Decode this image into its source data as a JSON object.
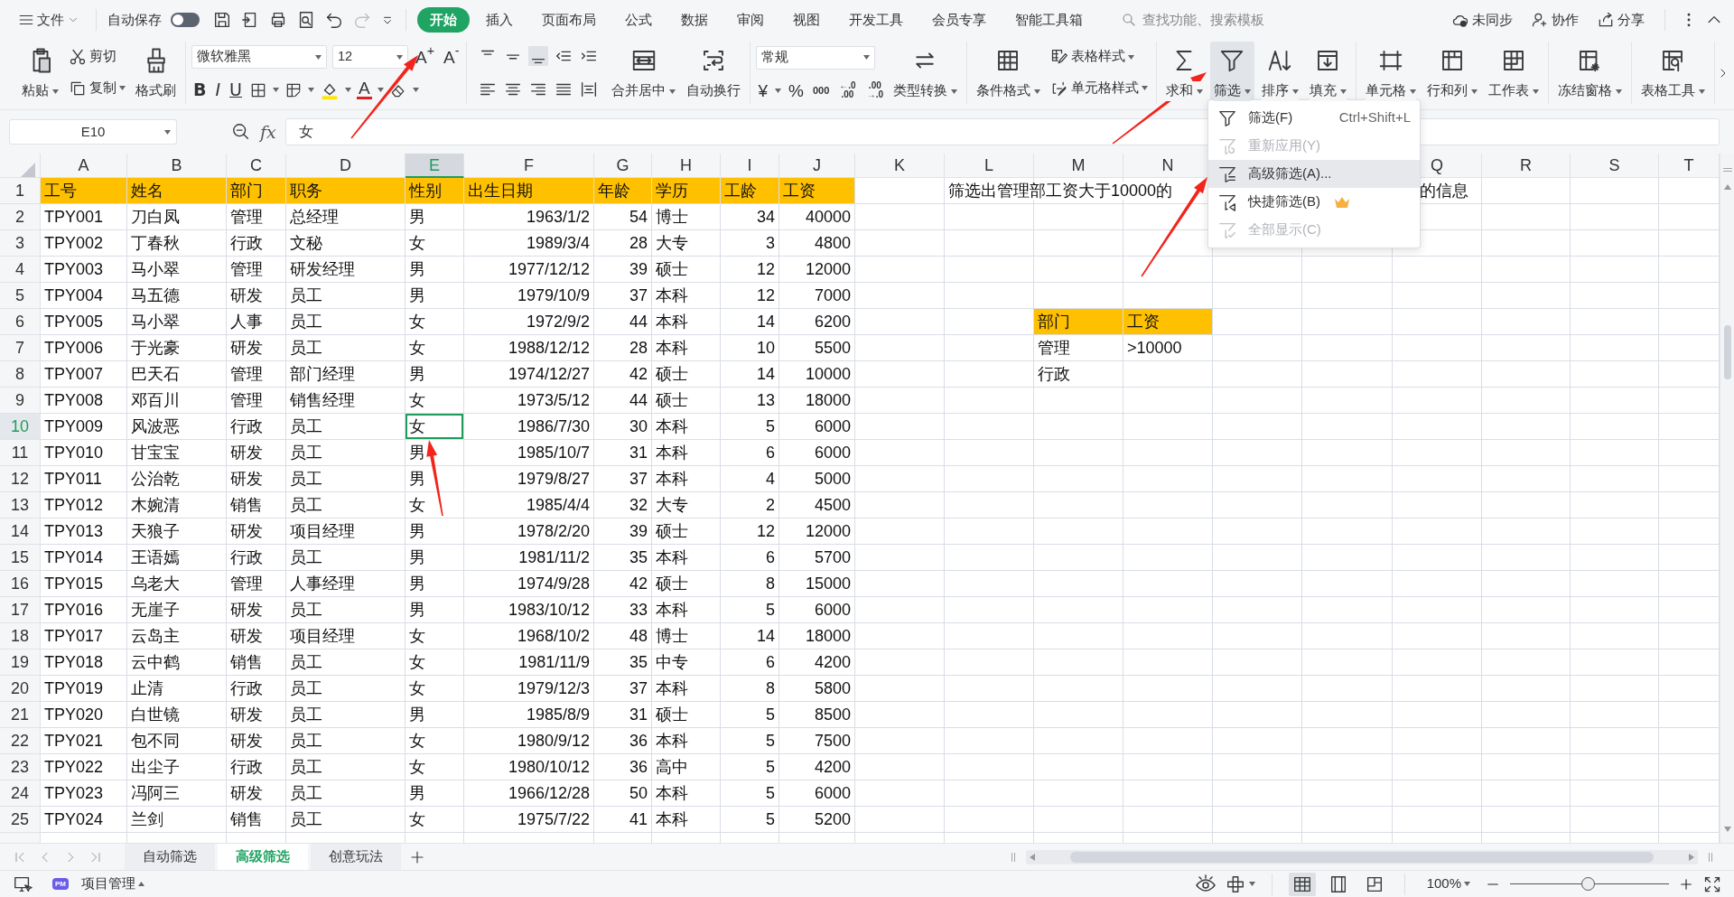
{
  "top_bar": {
    "file_menu": "文件",
    "autosave_label": "自动保存",
    "autosave_on": false,
    "redo_disabled": true,
    "tabs": [
      {
        "label": "开始",
        "selected": true
      },
      {
        "label": "插入",
        "selected": false
      },
      {
        "label": "页面布局",
        "selected": false
      },
      {
        "label": "公式",
        "selected": false
      },
      {
        "label": "数据",
        "selected": false
      },
      {
        "label": "审阅",
        "selected": false
      },
      {
        "label": "视图",
        "selected": false
      },
      {
        "label": "开发工具",
        "selected": false
      },
      {
        "label": "会员专享",
        "selected": false
      },
      {
        "label": "智能工具箱",
        "selected": false
      }
    ],
    "search": {
      "placeholder": "查找功能、搜索模板"
    },
    "actions": [
      {
        "label": "未同步"
      },
      {
        "label": "协作"
      },
      {
        "label": "分享"
      }
    ]
  },
  "ribbon": {
    "groups": [
      {
        "items": [
          {
            "kind": "big",
            "label": "粘贴",
            "caret": true,
            "expanded": false
          },
          {
            "kind": "stack",
            "items": [
              {
                "label": "剪切",
                "caret": false
              },
              {
                "label": "复制",
                "caret": true
              }
            ]
          },
          {
            "kind": "big",
            "label": "格式刷",
            "caret": false,
            "expanded": false
          }
        ]
      },
      {
        "items": [
          {
            "kind": "font",
            "font": "微软雅黑",
            "size": "12",
            "grow": "A$^{+}$",
            "shrink": "A$^{-}$",
            "styles": [
              "B",
              "I",
              "U"
            ],
            "font_color": "A"
          }
        ]
      },
      {
        "items": [
          {
            "kind": "align"
          },
          {
            "kind": "big",
            "label": "合并居中",
            "caret": true,
            "expanded": false
          },
          {
            "kind": "big",
            "label": "自动换行",
            "caret": false,
            "expanded": false
          }
        ]
      },
      {
        "items": [
          {
            "kind": "number",
            "format": "常规",
            "currency": "¥",
            "percent": "%",
            "thousands": "000",
            "decimals": [
              {
                "top": "←.0",
                "bottom": ".00"
              },
              {
                "top": ".00",
                "bottom": "→.0"
              }
            ]
          },
          {
            "kind": "big",
            "label": "类型转换",
            "caret": true,
            "expanded": false
          }
        ]
      },
      {
        "items": [
          {
            "kind": "big",
            "label": "条件格式",
            "caret": true,
            "expanded": false
          },
          {
            "kind": "stack",
            "items": [
              {
                "label": "表格样式",
                "caret": true
              },
              {
                "label": "单元格样式",
                "caret": true
              }
            ]
          }
        ]
      },
      {
        "items": [
          {
            "kind": "big",
            "label": "求和",
            "caret": true,
            "expanded": false
          },
          {
            "kind": "big",
            "label": "筛选",
            "caret": true,
            "expanded": true
          },
          {
            "kind": "big",
            "label": "排序",
            "caret": true,
            "expanded": false
          },
          {
            "kind": "big",
            "label": "填充",
            "caret": true,
            "expanded": false
          }
        ]
      },
      {
        "items": [
          {
            "kind": "big",
            "label": "单元格",
            "caret": true,
            "expanded": false
          },
          {
            "kind": "big",
            "label": "行和列",
            "caret": true,
            "expanded": false
          },
          {
            "kind": "big",
            "label": "工作表",
            "caret": true,
            "expanded": false
          }
        ]
      },
      {
        "items": [
          {
            "kind": "big",
            "label": "冻结窗格",
            "caret": true,
            "expanded": false
          }
        ]
      },
      {
        "items": [
          {
            "kind": "big",
            "label": "表格工具",
            "caret": true,
            "expanded": false
          }
        ]
      }
    ]
  },
  "formula_bar": {
    "name_box": "E10",
    "fx": "fx",
    "value": "女"
  },
  "sheet": {
    "columns": [
      {
        "letter": "A",
        "selected": false
      },
      {
        "letter": "B",
        "selected": false
      },
      {
        "letter": "C",
        "selected": false
      },
      {
        "letter": "D",
        "selected": false
      },
      {
        "letter": "E",
        "selected": true
      },
      {
        "letter": "F",
        "selected": false
      },
      {
        "letter": "G",
        "selected": false
      },
      {
        "letter": "H",
        "selected": false
      },
      {
        "letter": "I",
        "selected": false
      },
      {
        "letter": "J",
        "selected": false
      },
      {
        "letter": "K",
        "selected": false
      },
      {
        "letter": "L",
        "selected": false
      },
      {
        "letter": "M",
        "selected": false
      },
      {
        "letter": "N",
        "selected": false
      },
      {
        "letter": "Q",
        "selected": false
      },
      {
        "letter": "R",
        "selected": false
      },
      {
        "letter": "S",
        "selected": false
      },
      {
        "letter": "T",
        "selected": false
      }
    ],
    "rows": [
      {
        "number": "1",
        "kind": "header",
        "selected": false,
        "cells": [
          "工号",
          "姓名",
          "部门",
          "职务",
          "性别",
          "出生日期",
          "年龄",
          "学历",
          "工龄",
          "工资"
        ]
      },
      {
        "number": "2",
        "kind": "data",
        "selected": false,
        "cells": [
          "TPY001",
          "刀白凤",
          "管理",
          "总经理",
          "男",
          "1963/1/2",
          "54",
          "博士",
          "34",
          "40000"
        ]
      },
      {
        "number": "3",
        "kind": "data",
        "selected": false,
        "cells": [
          "TPY002",
          "丁春秋",
          "行政",
          "文秘",
          "女",
          "1989/3/4",
          "28",
          "大专",
          "3",
          "4800"
        ]
      },
      {
        "number": "4",
        "kind": "data",
        "selected": false,
        "cells": [
          "TPY003",
          "马小翠",
          "管理",
          "研发经理",
          "男",
          "1977/12/12",
          "39",
          "硕士",
          "12",
          "12000"
        ]
      },
      {
        "number": "5",
        "kind": "data",
        "selected": false,
        "cells": [
          "TPY004",
          "马五德",
          "研发",
          "员工",
          "男",
          "1979/10/9",
          "37",
          "本科",
          "12",
          "7000"
        ]
      },
      {
        "number": "6",
        "kind": "data",
        "selected": false,
        "cells": [
          "TPY005",
          "马小翠",
          "人事",
          "员工",
          "女",
          "1972/9/2",
          "44",
          "本科",
          "14",
          "6200"
        ]
      },
      {
        "number": "7",
        "kind": "data",
        "selected": false,
        "cells": [
          "TPY006",
          "于光豪",
          "研发",
          "员工",
          "女",
          "1988/12/12",
          "28",
          "本科",
          "10",
          "5500"
        ]
      },
      {
        "number": "8",
        "kind": "data",
        "selected": false,
        "cells": [
          "TPY007",
          "巴天石",
          "管理",
          "部门经理",
          "男",
          "1974/12/27",
          "42",
          "硕士",
          "14",
          "10000"
        ]
      },
      {
        "number": "9",
        "kind": "data",
        "selected": false,
        "cells": [
          "TPY008",
          "邓百川",
          "管理",
          "销售经理",
          "女",
          "1973/5/12",
          "44",
          "硕士",
          "13",
          "18000"
        ]
      },
      {
        "number": "10",
        "kind": "data",
        "selected": true,
        "cells": [
          "TPY009",
          "风波恶",
          "行政",
          "员工",
          "女",
          "1986/7/30",
          "30",
          "本科",
          "5",
          "6000"
        ]
      },
      {
        "number": "11",
        "kind": "data",
        "selected": false,
        "cells": [
          "TPY010",
          "甘宝宝",
          "研发",
          "员工",
          "男",
          "1985/10/7",
          "31",
          "本科",
          "6",
          "6000"
        ]
      },
      {
        "number": "12",
        "kind": "data",
        "selected": false,
        "cells": [
          "TPY011",
          "公治乾",
          "研发",
          "员工",
          "男",
          "1979/8/27",
          "37",
          "本科",
          "4",
          "5000"
        ]
      },
      {
        "number": "13",
        "kind": "data",
        "selected": false,
        "cells": [
          "TPY012",
          "木婉清",
          "销售",
          "员工",
          "女",
          "1985/4/4",
          "32",
          "大专",
          "2",
          "4500"
        ]
      },
      {
        "number": "14",
        "kind": "data",
        "selected": false,
        "cells": [
          "TPY013",
          "天狼子",
          "研发",
          "项目经理",
          "男",
          "1978/2/20",
          "39",
          "硕士",
          "12",
          "12000"
        ]
      },
      {
        "number": "15",
        "kind": "data",
        "selected": false,
        "cells": [
          "TPY014",
          "王语嫣",
          "行政",
          "员工",
          "男",
          "1981/11/2",
          "35",
          "本科",
          "6",
          "5700"
        ]
      },
      {
        "number": "16",
        "kind": "data",
        "selected": false,
        "cells": [
          "TPY015",
          "乌老大",
          "管理",
          "人事经理",
          "男",
          "1974/9/28",
          "42",
          "硕士",
          "8",
          "15000"
        ]
      },
      {
        "number": "17",
        "kind": "data",
        "selected": false,
        "cells": [
          "TPY016",
          "无崖子",
          "研发",
          "员工",
          "男",
          "1983/10/12",
          "33",
          "本科",
          "5",
          "6000"
        ]
      },
      {
        "number": "18",
        "kind": "data",
        "selected": false,
        "cells": [
          "TPY017",
          "云岛主",
          "研发",
          "项目经理",
          "女",
          "1968/10/2",
          "48",
          "博士",
          "14",
          "18000"
        ]
      },
      {
        "number": "19",
        "kind": "data",
        "selected": false,
        "cells": [
          "TPY018",
          "云中鹤",
          "销售",
          "员工",
          "女",
          "1981/11/9",
          "35",
          "中专",
          "6",
          "4200"
        ]
      },
      {
        "number": "20",
        "kind": "data",
        "selected": false,
        "cells": [
          "TPY019",
          "止清",
          "行政",
          "员工",
          "女",
          "1979/12/3",
          "37",
          "本科",
          "8",
          "5800"
        ]
      },
      {
        "number": "21",
        "kind": "data",
        "selected": false,
        "cells": [
          "TPY020",
          "白世镜",
          "研发",
          "员工",
          "男",
          "1985/8/9",
          "31",
          "硕士",
          "5",
          "8500"
        ]
      },
      {
        "number": "22",
        "kind": "data",
        "selected": false,
        "cells": [
          "TPY021",
          "包不同",
          "研发",
          "员工",
          "女",
          "1980/9/12",
          "36",
          "本科",
          "5",
          "7500"
        ]
      },
      {
        "number": "23",
        "kind": "data",
        "selected": false,
        "cells": [
          "TPY022",
          "出尘子",
          "行政",
          "员工",
          "女",
          "1980/10/12",
          "36",
          "高中",
          "5",
          "4200"
        ]
      },
      {
        "number": "24",
        "kind": "data",
        "selected": false,
        "cells": [
          "TPY023",
          "冯阿三",
          "研发",
          "员工",
          "男",
          "1966/12/28",
          "50",
          "本科",
          "5",
          "6000"
        ]
      },
      {
        "number": "25",
        "kind": "data",
        "selected": false,
        "cells": [
          "TPY024",
          "兰剑",
          "销售",
          "员工",
          "女",
          "1975/7/22",
          "41",
          "本科",
          "5",
          "5200"
        ]
      }
    ],
    "note": {
      "start": "筛选出管理部工资大于10000的",
      "end": "的信息"
    },
    "criteria": {
      "header": [
        "部门",
        "工资"
      ],
      "rows": [
        [
          "管理",
          ">10000"
        ],
        [
          "行政"
        ]
      ]
    }
  },
  "filter_menu": {
    "items": [
      {
        "label": "筛选(F)",
        "shortcut": "Ctrl+Shift+L",
        "disabled": false,
        "selected": false,
        "premium": false
      },
      {
        "label": "重新应用(Y)",
        "disabled": true,
        "selected": false,
        "premium": false
      },
      {
        "label": "高级筛选(A)...",
        "disabled": false,
        "selected": true,
        "premium": false
      },
      {
        "label": "快捷筛选(B)",
        "disabled": false,
        "selected": false,
        "premium": true
      },
      {
        "label": "全部显示(C)",
        "disabled": true,
        "selected": false,
        "premium": false
      }
    ]
  },
  "sheet_tabs": [
    {
      "label": "自动筛选",
      "selected": false
    },
    {
      "label": "高级筛选",
      "selected": true
    },
    {
      "label": "创意玩法",
      "selected": false
    }
  ],
  "status_bar": {
    "badge": "PM",
    "project": "项目管理",
    "views": [
      {
        "selected": true
      },
      {
        "selected": false
      },
      {
        "selected": false
      }
    ],
    "zoom": "100%",
    "zoom_slider": {
      "level": 0.49
    }
  }
}
